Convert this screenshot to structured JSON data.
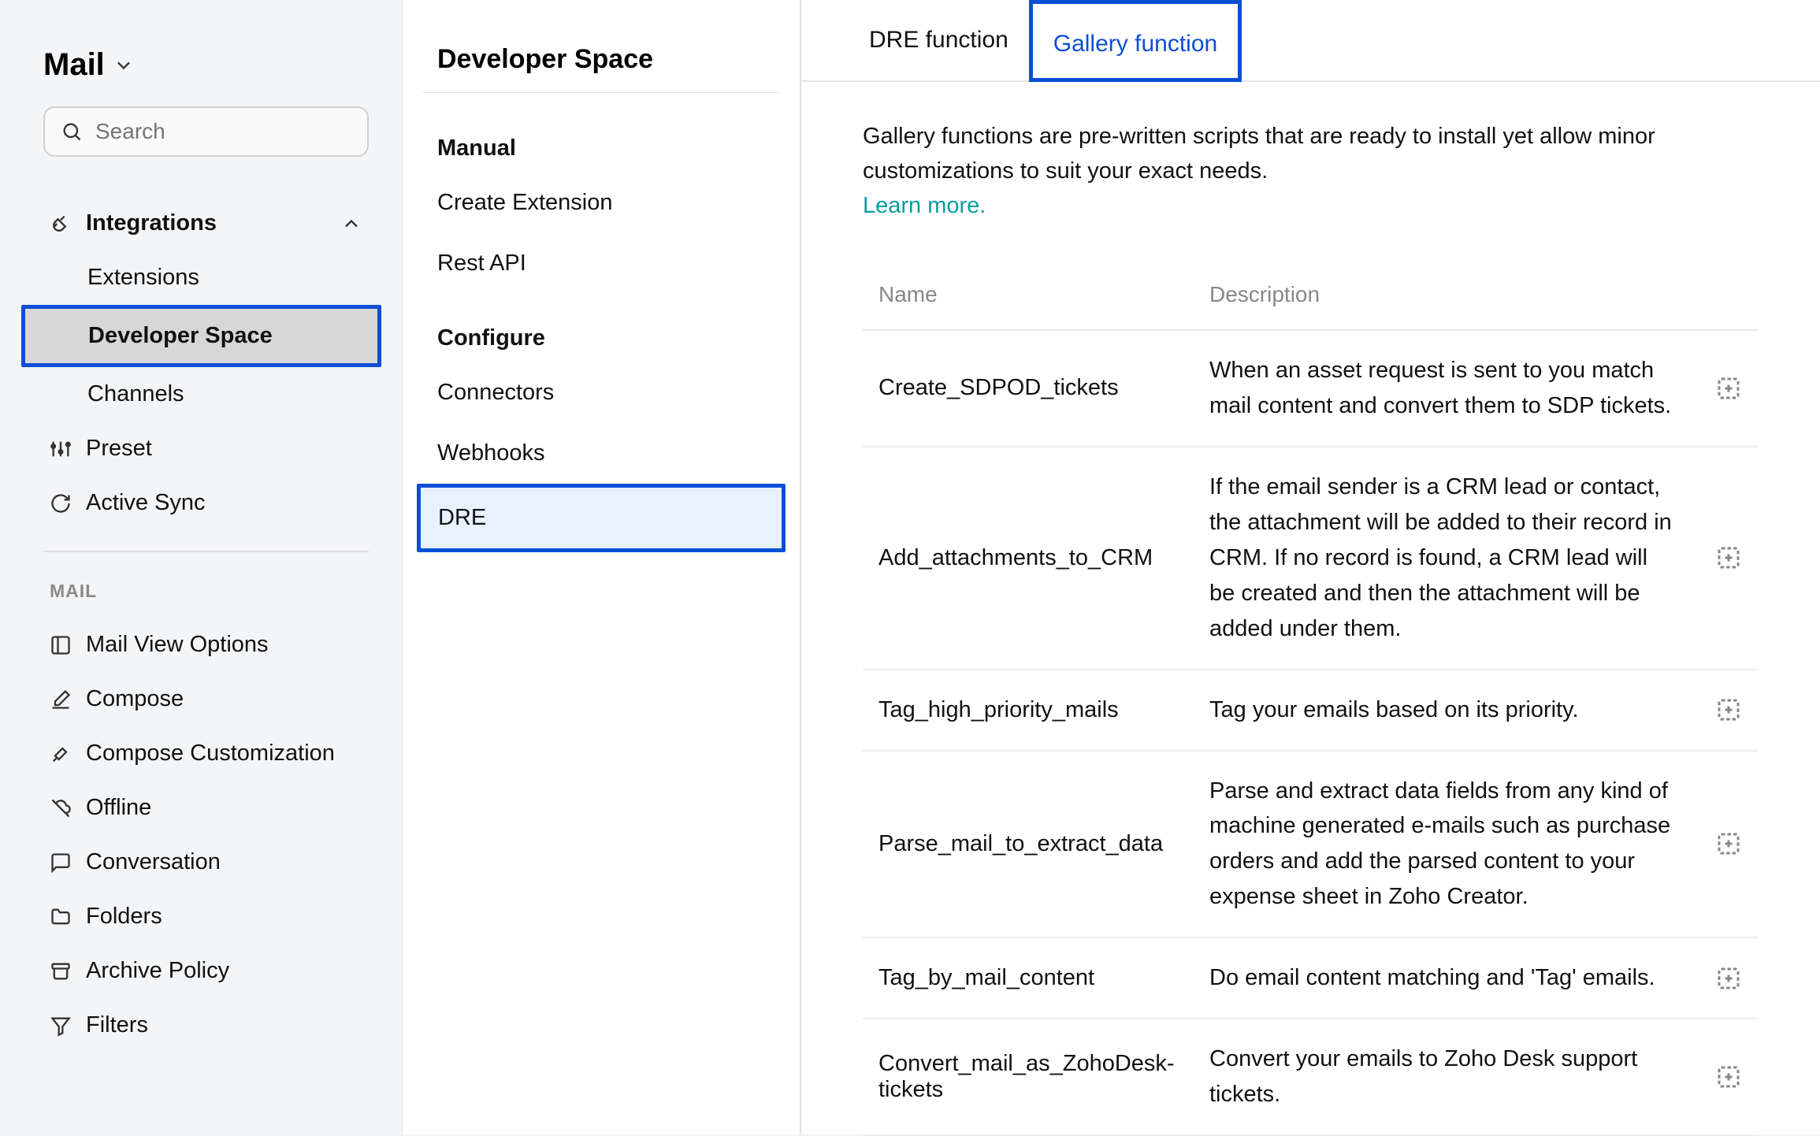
{
  "app": {
    "title": "Mail"
  },
  "search": {
    "placeholder": "Search"
  },
  "sidebar": {
    "integrations": {
      "label": "Integrations",
      "items": [
        {
          "label": "Extensions"
        },
        {
          "label": "Developer Space"
        },
        {
          "label": "Channels"
        }
      ]
    },
    "preset": {
      "label": "Preset"
    },
    "active_sync": {
      "label": "Active Sync"
    },
    "section_mail": {
      "label": "MAIL"
    },
    "mail_items": [
      {
        "label": "Mail View Options"
      },
      {
        "label": "Compose"
      },
      {
        "label": "Compose Customization"
      },
      {
        "label": "Offline"
      },
      {
        "label": "Conversation"
      },
      {
        "label": "Folders"
      },
      {
        "label": "Archive Policy"
      },
      {
        "label": "Filters"
      }
    ]
  },
  "col2": {
    "title": "Developer Space",
    "groups": [
      {
        "label": "Manual",
        "items": [
          "Create Extension",
          "Rest API"
        ]
      },
      {
        "label": "Configure",
        "items": [
          "Connectors",
          "Webhooks",
          "DRE"
        ]
      }
    ]
  },
  "tabs": [
    {
      "label": "DRE function",
      "active": false
    },
    {
      "label": "Gallery function",
      "active": true
    }
  ],
  "content": {
    "intro": "Gallery functions are pre-written scripts that are ready to install yet allow minor customizations to suit your exact needs.",
    "learn_more": "Learn more.",
    "columns": {
      "name": "Name",
      "description": "Description"
    },
    "rows": [
      {
        "name": "Create_SDPOD_tickets",
        "desc": "When an asset request is sent to you match mail content and convert them to SDP tickets."
      },
      {
        "name": "Add_attachments_to_CRM",
        "desc": "If the email sender is a CRM lead or contact, the attachment will be added to their record in CRM. If no record is found, a CRM lead will be created and then the attachment will be added under them."
      },
      {
        "name": "Tag_high_priority_mails",
        "desc": "Tag your emails based on its priority."
      },
      {
        "name": "Parse_mail_to_extract_data",
        "desc": "Parse and extract data fields from any kind of machine generated e-mails such as purchase orders and add the parsed content to your expense sheet in Zoho Creator."
      },
      {
        "name": "Tag_by_mail_content",
        "desc": "Do email content matching and 'Tag' emails."
      },
      {
        "name": "Convert_mail_as_ZohoDesk-tickets",
        "desc": "Convert your emails to Zoho Desk support tickets."
      }
    ]
  }
}
